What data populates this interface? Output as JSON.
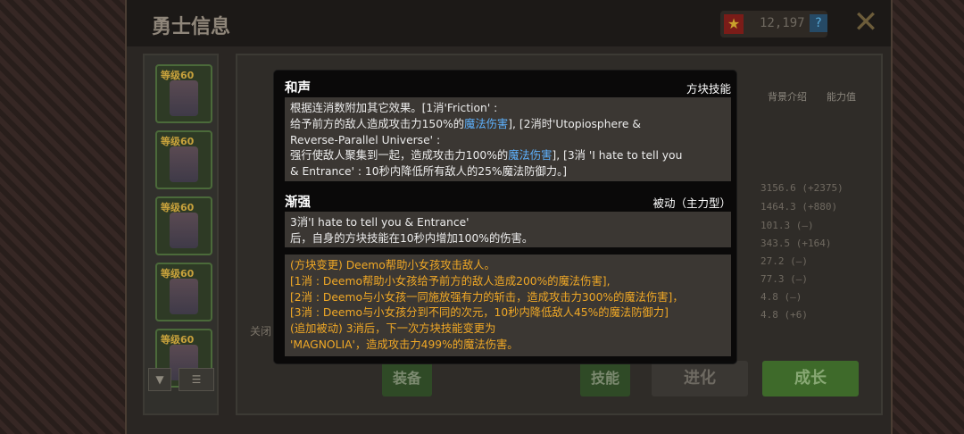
{
  "header": {
    "title": "勇士信息",
    "currency_value": "12,197",
    "help_glyph": "?",
    "close_glyph": "✕"
  },
  "hero_list": {
    "level_label": "等级60",
    "cards": [
      {
        "level": "等级60"
      },
      {
        "level": "等级60"
      },
      {
        "level": "等级60"
      },
      {
        "level": "等级60"
      },
      {
        "level": "等级60"
      }
    ]
  },
  "background_panel": {
    "tab_profile": "背景介绍",
    "tab_stats": "能力值",
    "close_label": "关闭",
    "stats": [
      "3156.6 (+2375)",
      "1464.3 (+880)",
      "101.3 (–)",
      "343.5 (+164)",
      "27.2 (–)",
      "77.3 (–)",
      "4.8 (–)",
      "4.8 (+6)"
    ],
    "btn_equip": "装备",
    "btn_skill": "技能",
    "btn_evolve": "进化",
    "btn_grow": "成长"
  },
  "popup": {
    "skill1": {
      "title": "和声",
      "tag": "方块技能",
      "lines": [
        {
          "parts": [
            {
              "t": "根据连消数附加其它效果。[1消'Friction' :"
            }
          ]
        },
        {
          "parts": [
            {
              "t": "给予前方的敌人造成攻击力150%的"
            },
            {
              "t": "魔法伤害",
              "hl": true
            },
            {
              "t": "], [2消时'Utopiosphere &"
            }
          ]
        },
        {
          "parts": [
            {
              "t": "Reverse-Parallel Universe' :"
            }
          ]
        },
        {
          "parts": [
            {
              "t": "强行使敌人聚集到一起，造成攻击力100%的"
            },
            {
              "t": "魔法伤害",
              "hl": true
            },
            {
              "t": "], [3消 'I hate to tell you"
            }
          ]
        },
        {
          "parts": [
            {
              "t": "& Entrance' : 10秒内降低所有敌人的25%魔法防御力。]"
            }
          ]
        }
      ]
    },
    "skill2": {
      "title": "渐强",
      "tag": "被动（主力型）",
      "lines": [
        "3消'I hate to tell you & Entrance'",
        "后，自身的方块技能在10秒内增加100%的伤害。"
      ]
    },
    "evolved": {
      "lines": [
        "(方块变更) Deemo帮助小女孩攻击敌人。",
        "[1消 : Deemo帮助小女孩给予前方的敌人造成200%的魔法伤害],",
        "[2消 : Deemo与小女孩一同施放强有力的斩击，造成攻击力300%的魔法伤害]，",
        "[3消 : Deemo与小女孩分到不同的次元，10秒内降低敌人45%的魔法防御力]",
        "(追加被动) 3消后，下一次方块技能变更为",
        "'MAGNOLIA'，造成攻击力499%的魔法伤害。"
      ]
    }
  }
}
